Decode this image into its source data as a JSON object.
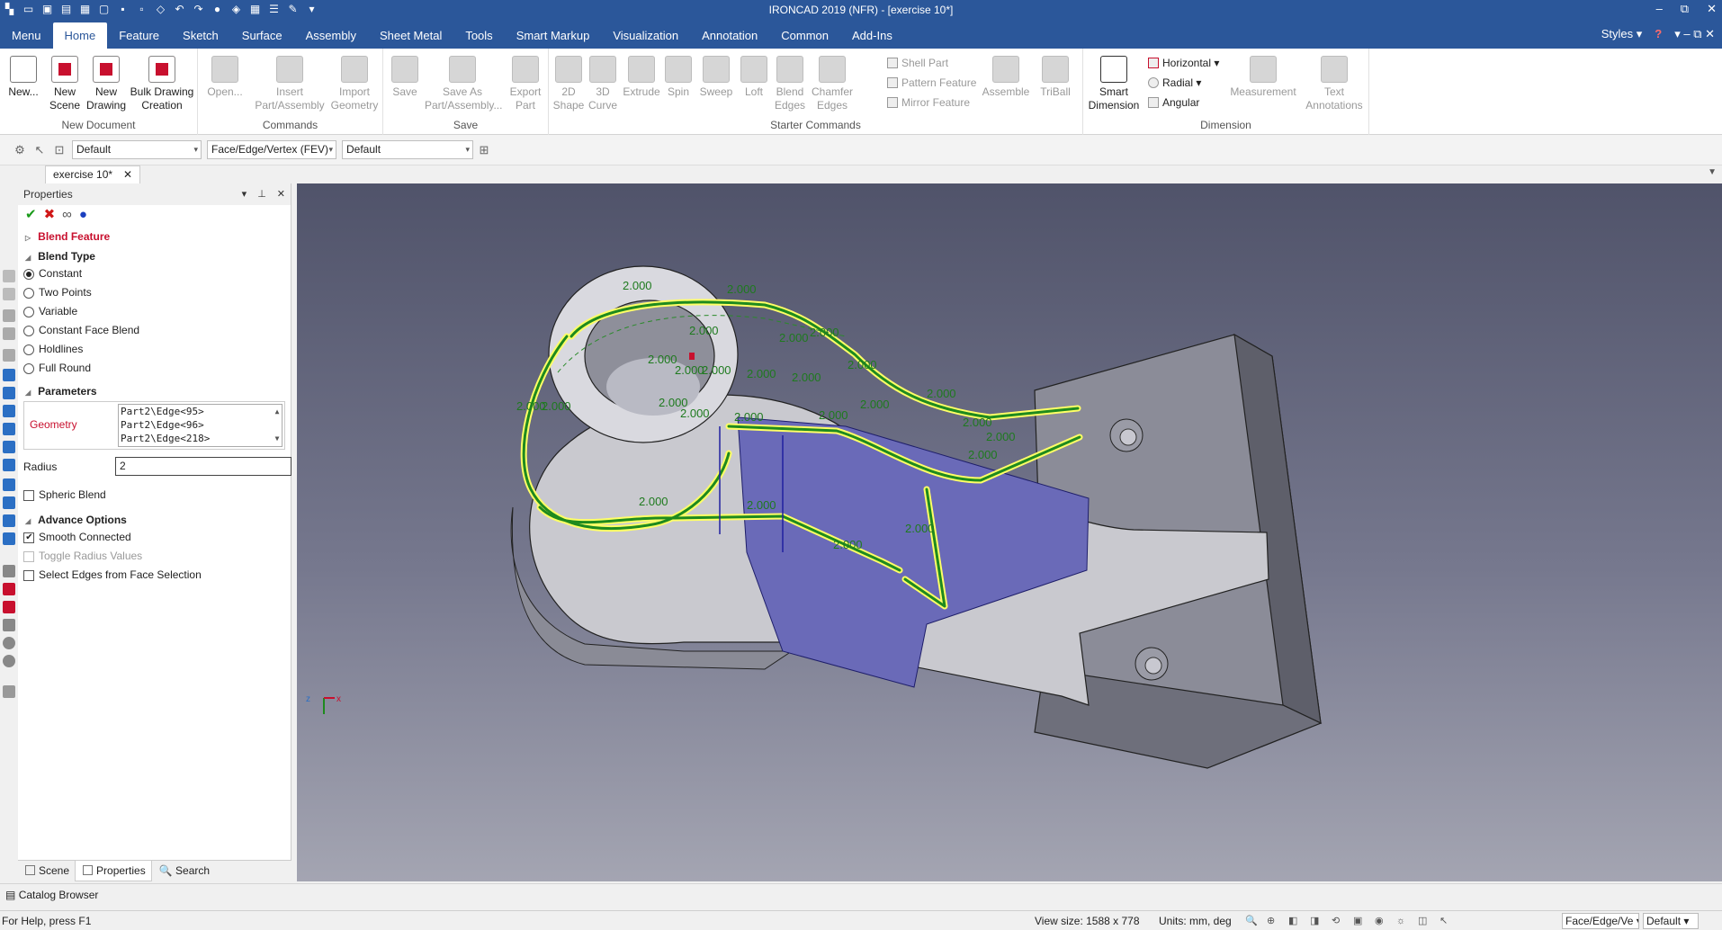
{
  "app": {
    "title": "IRONCAD 2019 (NFR) - [exercise 10*]",
    "window_buttons": [
      "–",
      "⧉",
      "✕"
    ]
  },
  "menu": {
    "tabs": [
      "Menu",
      "Home",
      "Feature",
      "Sketch",
      "Surface",
      "Assembly",
      "Sheet Metal",
      "Tools",
      "Smart Markup",
      "Visualization",
      "Annotation",
      "Common",
      "Add-Ins"
    ],
    "active": "Home",
    "styles_label": "Styles",
    "help_icon": "?"
  },
  "ribbon": {
    "new_document": {
      "label": "New Document",
      "new": "New...",
      "new_scene": [
        "New",
        "Scene"
      ],
      "new_drawing": [
        "New",
        "Drawing"
      ],
      "bulk": [
        "Bulk Drawing",
        "Creation"
      ]
    },
    "commands": {
      "label": "Commands",
      "open": "Open...",
      "insert": [
        "Insert",
        "Part/Assembly"
      ],
      "import": [
        "Import",
        "Geometry"
      ]
    },
    "save": {
      "label": "Save",
      "save": "Save",
      "save_as": [
        "Save As",
        "Part/Assembly..."
      ],
      "export": [
        "Export",
        "Part"
      ]
    },
    "starter": {
      "label": "Starter Commands",
      "shape2d": [
        "2D",
        "Shape"
      ],
      "curve3d": [
        "3D",
        "Curve"
      ],
      "extrude": "Extrude",
      "spin": "Spin",
      "sweep": "Sweep",
      "loft": "Loft",
      "blend": [
        "Blend",
        "Edges"
      ],
      "chamfer": [
        "Chamfer",
        "Edges"
      ],
      "shell": "Shell Part",
      "pattern": "Pattern Feature",
      "mirror": "Mirror Feature",
      "assemble": "Assemble",
      "triball": "TriBall"
    },
    "dimension": {
      "label": "Dimension",
      "smart": [
        "Smart",
        "Dimension"
      ],
      "horizontal": "Horizontal",
      "radial": "Radial",
      "angular": "Angular",
      "measurement": "Measurement",
      "text": [
        "Text",
        "Annotations"
      ]
    }
  },
  "selection_toolbar": {
    "combo1": "Default",
    "combo2": "Face/Edge/Vertex (FEV)",
    "combo3": "Default"
  },
  "doc_tab": {
    "name": "exercise 10*",
    "close": "✕"
  },
  "properties": {
    "title": "Properties",
    "feature": "Blend Feature",
    "blend_type": {
      "heading": "Blend Type",
      "options": [
        "Constant",
        "Two Points",
        "Variable",
        "Constant Face Blend",
        "Holdlines",
        "Full Round"
      ],
      "selected": "Constant"
    },
    "parameters": {
      "heading": "Parameters",
      "geometry_label": "Geometry",
      "geometry": [
        "Part2\\Edge<95>",
        "Part2\\Edge<96>",
        "Part2\\Edge<218>"
      ],
      "radius_label": "Radius",
      "radius": "2"
    },
    "spheric_blend": "Spheric Blend",
    "advance": {
      "heading": "Advance Options",
      "smooth": "Smooth Connected",
      "toggle": "Toggle Radius Values",
      "select_edges": "Select Edges from Face Selection"
    }
  },
  "bottom_tabs": [
    "Scene",
    "Properties",
    "Search"
  ],
  "catalog": "Catalog Browser",
  "viewport": {
    "dim_labels": [
      "2.000",
      "2.000",
      "2.000",
      "2.000",
      "2.000",
      "2.000",
      "2.000",
      "2.000",
      "2.000",
      "2.000",
      "2.000",
      "2.000",
      "2.000",
      "2.000",
      "2.000",
      "2.000",
      "2.000",
      "2.000",
      "2.000",
      "2.000",
      "2.000",
      "2.000",
      "2.000",
      "2.000",
      "2.000",
      "2.000"
    ],
    "colors": {
      "edge_green": "#1e8a1e",
      "highlight_yellow": "#ffff66",
      "face_blue": "#6a6ab8",
      "part_gray": "#c9c9cf"
    },
    "triad": {
      "x": "x",
      "z": "z"
    }
  },
  "status": {
    "help": "For Help, press F1",
    "view_size": "View size: 1588 x  778",
    "units": "Units: mm, deg",
    "filter": "Face/Edge/Ve",
    "style": "Default"
  }
}
